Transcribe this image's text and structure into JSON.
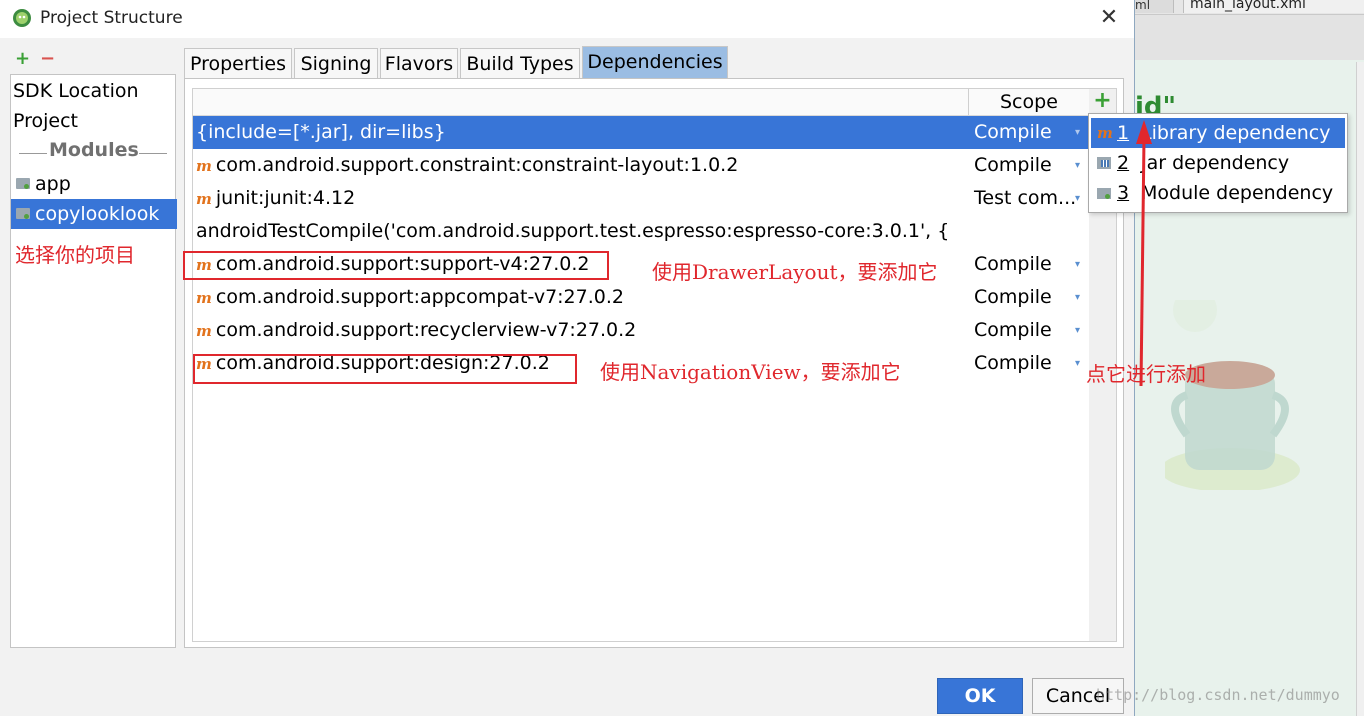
{
  "window": {
    "title": "Project Structure",
    "close_glyph": "✕"
  },
  "background_ide": {
    "tab1": "ml",
    "tab2": "main_layout.xml",
    "code_fragment": "id\""
  },
  "modules_toolbar": {
    "add": "+",
    "remove": "−"
  },
  "sidebar": {
    "items": [
      {
        "label": "SDK Location"
      },
      {
        "label": "Project"
      }
    ],
    "modules_header": "Modules",
    "modules": [
      {
        "label": "app"
      },
      {
        "label": "copylooklook",
        "selected": true
      }
    ]
  },
  "tabs": [
    {
      "label": "Properties"
    },
    {
      "label": "Signing"
    },
    {
      "label": "Flavors"
    },
    {
      "label": "Build Types"
    },
    {
      "label": "Dependencies",
      "active": true
    }
  ],
  "dependencies": {
    "scope_header": "Scope",
    "add_glyph": "+",
    "rows": [
      {
        "name": "{include=[*.jar], dir=libs}",
        "scope": "Compile",
        "icon": "",
        "selected": true
      },
      {
        "name": "com.android.support.constraint:constraint-layout:1.0.2",
        "scope": "Compile",
        "icon": "m"
      },
      {
        "name": "junit:junit:4.12",
        "scope": "Test com...",
        "icon": "m"
      },
      {
        "name": "androidTestCompile('com.android.support.test.espresso:espresso-core:3.0.1', {",
        "scope": "",
        "icon": ""
      },
      {
        "name": "com.android.support:support-v4:27.0.2",
        "scope": "Compile",
        "icon": "m"
      },
      {
        "name": "com.android.support:appcompat-v7:27.0.2",
        "scope": "Compile",
        "icon": "m"
      },
      {
        "name": "com.android.support:recyclerview-v7:27.0.2",
        "scope": "Compile",
        "icon": "m"
      },
      {
        "name": "com.android.support:design:27.0.2",
        "scope": "Compile",
        "icon": "m"
      }
    ]
  },
  "add_menu": {
    "items": [
      {
        "num": "1",
        "label": "Library dependency",
        "icon": "m",
        "selected": true
      },
      {
        "num": "2",
        "label": "Jar dependency",
        "icon": "jar-icon"
      },
      {
        "num": "3",
        "label": "Module dependency",
        "icon": "module-icon"
      }
    ]
  },
  "annotations": {
    "select_project": "选择你的项目",
    "drawer_note": "使用DrawerLayout，要添加它",
    "navigation_note": "使用NavigationView，要添加它",
    "click_add": "点它进行添加"
  },
  "buttons": {
    "ok": "OK",
    "cancel": "Cancel"
  },
  "watermark": "http://blog.csdn.net/dummyo",
  "colors": {
    "selection": "#3875d7",
    "annotation": "#e0272d",
    "active_tab": "#9bbde3",
    "maven_icon": "#e2731d"
  }
}
